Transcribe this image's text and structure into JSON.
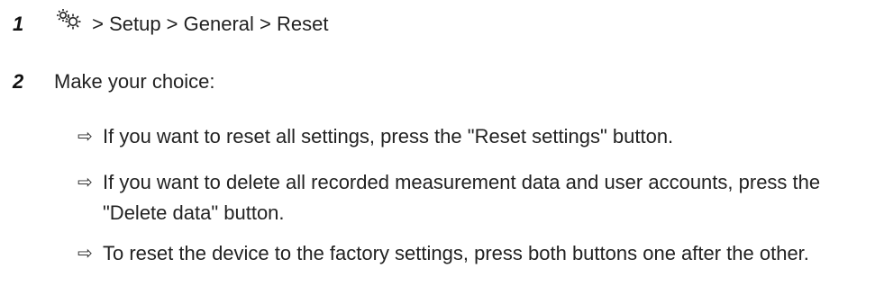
{
  "steps": [
    {
      "number": "1",
      "icon": "gear-icon",
      "text": " > Setup > General > Reset"
    },
    {
      "number": "2",
      "text": "Make your choice:"
    }
  ],
  "results": [
    {
      "icon": "result-arrow-icon",
      "arrow": "⇨",
      "text": "If you want to reset all settings, press the \"Reset settings\" button."
    },
    {
      "icon": "result-arrow-icon",
      "arrow": "⇨",
      "text": "If you want to delete all recorded measurement data and user accounts, press the \"Delete data\" button."
    },
    {
      "icon": "result-arrow-icon",
      "arrow": "⇨",
      "text": "To reset the device to the factory settings, press both buttons one after the other."
    }
  ]
}
